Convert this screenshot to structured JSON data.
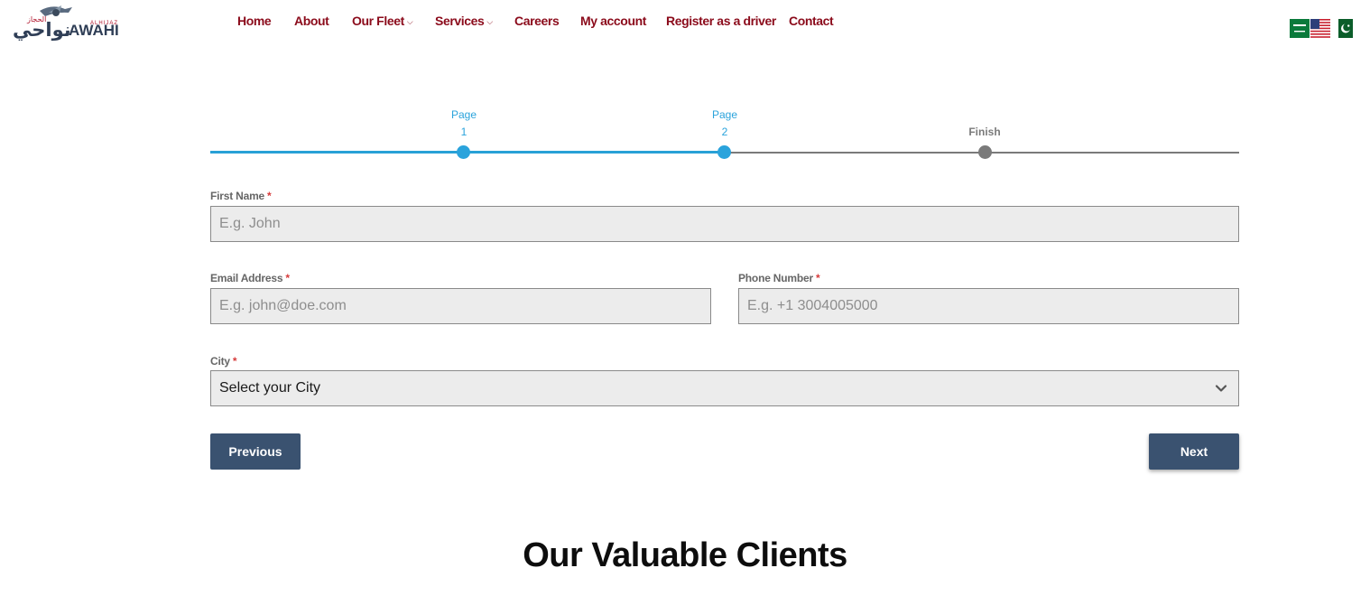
{
  "brand": {
    "logo_text": "AWAHI",
    "logo_arabic": "نواحي",
    "logo_sub": "ALHIJAZ"
  },
  "nav": {
    "items": [
      {
        "label": "Home"
      },
      {
        "label": "About"
      },
      {
        "label": "Our Fleet",
        "dropdown": true
      },
      {
        "label": "Services",
        "dropdown": true
      },
      {
        "label": "Careers"
      },
      {
        "label": "My account"
      },
      {
        "label": "Register as a driver"
      },
      {
        "label": "Contact"
      }
    ],
    "chevron": "⌵"
  },
  "languages": [
    {
      "icon": "saudi-flag-icon"
    },
    {
      "icon": "us-flag-icon"
    },
    {
      "icon": "pakistan-flag-icon"
    }
  ],
  "progress": {
    "steps": [
      {
        "line1": "Page",
        "line2": "1",
        "state": "complete"
      },
      {
        "line1": "Page",
        "line2": "2",
        "state": "current"
      },
      {
        "line1": "",
        "line2": "Finish",
        "state": "pending"
      }
    ],
    "active_color": "#2aa3dc",
    "inactive_color": "#7a7a7a"
  },
  "form": {
    "required_marker": "*",
    "first_name": {
      "label": "First Name",
      "placeholder": "E.g. John",
      "value": ""
    },
    "email": {
      "label": "Email Address",
      "placeholder": "E.g. john@doe.com",
      "value": ""
    },
    "phone": {
      "label": "Phone Number",
      "placeholder": "E.g. +1 3004005000",
      "value": ""
    },
    "city": {
      "label": "City",
      "selected": "Select your City"
    },
    "previous_label": "Previous",
    "next_label": "Next"
  },
  "clients": {
    "title": "Our Valuable Clients"
  },
  "colors": {
    "nav_text": "#8b0b1b",
    "button_bg": "#3a5270",
    "field_bg": "#ececec"
  }
}
